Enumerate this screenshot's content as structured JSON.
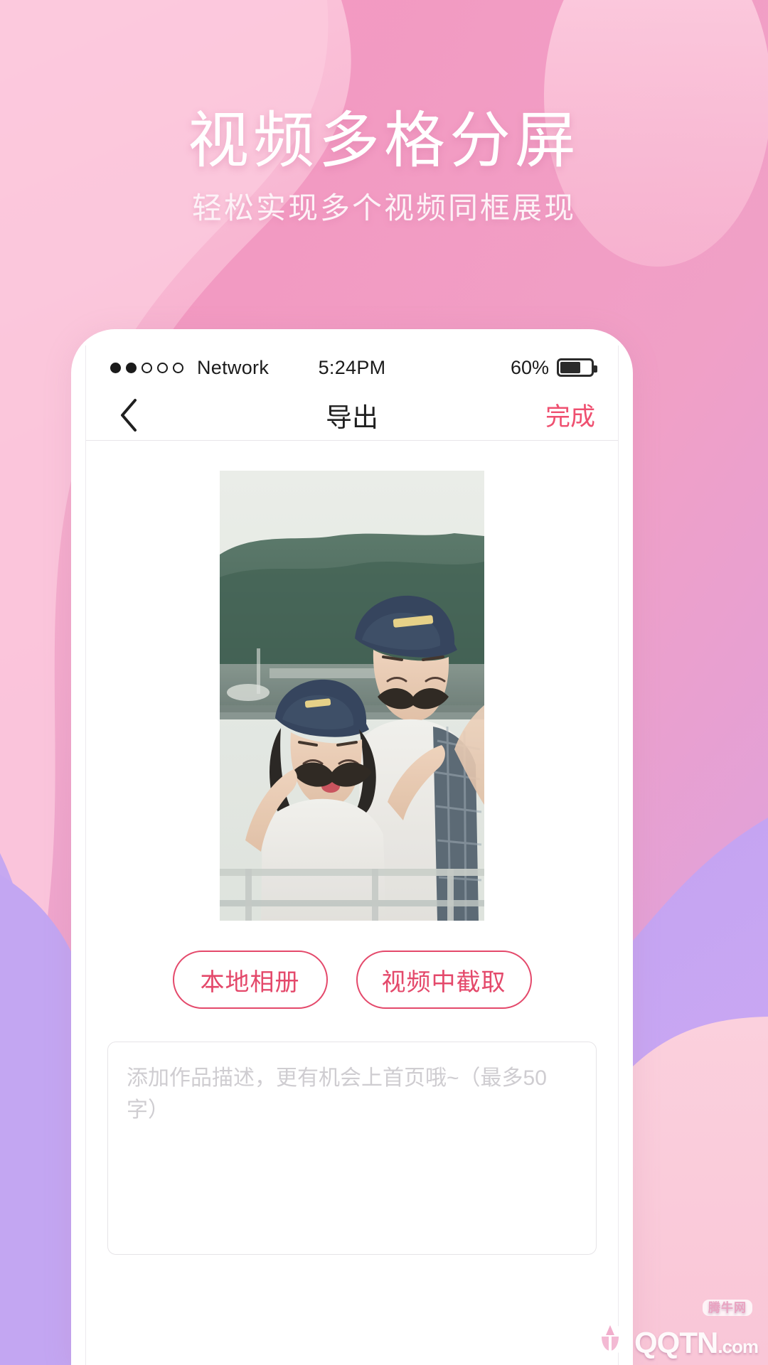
{
  "promo": {
    "title": "视频多格分屏",
    "subtitle": "轻松实现多个视频同框展现"
  },
  "colors": {
    "bg_pink_light": "#fbc4d9",
    "bg_pink_mid": "#f49ec4",
    "bg_pink_deep": "#f08cb8",
    "bg_purple": "#c3a6f2",
    "bg_pink_pale": "#fbd3e0",
    "accent_pink": "#ef5070",
    "button_border": "#e4496b",
    "text_dark": "#1f1f1f",
    "placeholder": "#cfcdd1"
  },
  "statusbar": {
    "signal_dots": [
      true,
      true,
      false,
      false,
      false
    ],
    "carrier": "Network",
    "time": "5:24PM",
    "battery_percent": "60%",
    "battery_level": 60
  },
  "navbar": {
    "back_icon": "chevron-left-icon",
    "title": "导出",
    "done_label": "完成"
  },
  "preview": {
    "alt": "couple-photo-preview"
  },
  "source_buttons": [
    {
      "label": "本地相册",
      "name": "local-album-button"
    },
    {
      "label": "视频中截取",
      "name": "capture-from-video-button"
    }
  ],
  "description": {
    "value": "",
    "placeholder": "添加作品描述，更有机会上首页哦~（最多50字）"
  },
  "watermark": {
    "name": "QQTN",
    "domain": ".com",
    "badge": "腾牛网"
  }
}
